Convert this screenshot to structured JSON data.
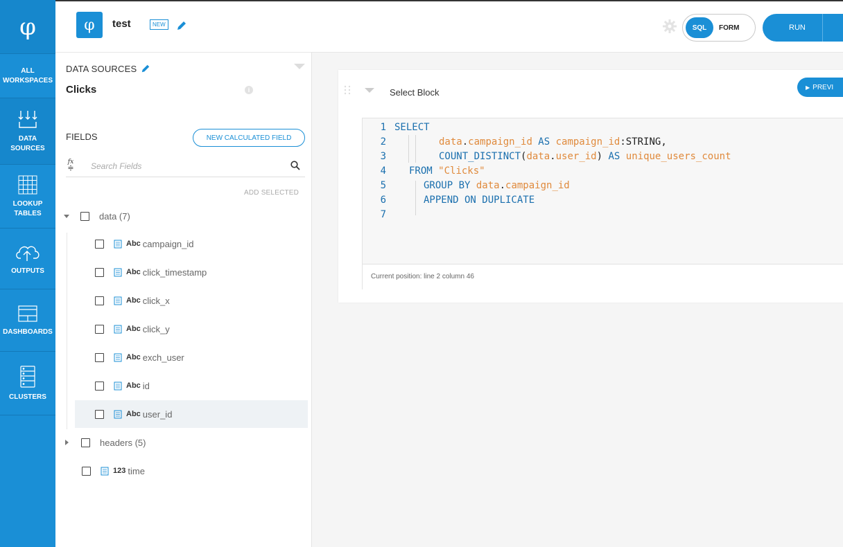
{
  "nav": {
    "logo": "φ",
    "items": [
      {
        "label_line1": "ALL",
        "label_line2": "WORKSPACES",
        "icon": "workspaces-icon"
      },
      {
        "label_line1": "DATA",
        "label_line2": "SOURCES",
        "icon": "data-sources-icon"
      },
      {
        "label_line1": "LOOKUP",
        "label_line2": "TABLES",
        "icon": "grid-icon"
      },
      {
        "label_line1": "OUTPUTS",
        "label_line2": "",
        "icon": "cloud-upload-icon"
      },
      {
        "label_line1": "DASHBOARDS",
        "label_line2": "",
        "icon": "dashboard-icon"
      },
      {
        "label_line1": "CLUSTERS",
        "label_line2": "",
        "icon": "server-icon"
      }
    ]
  },
  "topbar": {
    "workspace_logo": "φ",
    "workspace_name": "test",
    "badge": "NEW",
    "mode_sql": "SQL",
    "mode_form": "FORM",
    "run_label": "RUN"
  },
  "panel": {
    "data_sources_title": "DATA SOURCES",
    "source_name": "Clicks",
    "info": "i",
    "fields_title": "FIELDS",
    "new_calc_label": "NEW CALCULATED FIELD",
    "fx_label": "fx",
    "search_placeholder": "Search Fields",
    "add_selected": "ADD SELECTED",
    "groups": [
      {
        "name": "data (7)",
        "expanded": true,
        "fields": [
          {
            "type": "Abc",
            "name": "campaign_id"
          },
          {
            "type": "Abc",
            "name": "click_timestamp"
          },
          {
            "type": "Abc",
            "name": "click_x"
          },
          {
            "type": "Abc",
            "name": "click_y"
          },
          {
            "type": "Abc",
            "name": "exch_user"
          },
          {
            "type": "Abc",
            "name": "id"
          },
          {
            "type": "Abc",
            "name": "user_id"
          }
        ]
      },
      {
        "name": "headers (5)",
        "expanded": false
      }
    ],
    "root_field": {
      "type": "123",
      "name": "time"
    }
  },
  "editor": {
    "block_title": "Select Block",
    "preview_label": "PREVI",
    "line_numbers": [
      "1",
      "2",
      "3",
      "4",
      "5",
      "6",
      "7"
    ],
    "code": {
      "l1_kw": "SELECT",
      "l2_a": "data",
      "l2_b": ".",
      "l2_c": "campaign_id",
      "l2_d": " AS ",
      "l2_e": "campaign_id",
      "l2_f": ":STRING,",
      "l3_a": "COUNT_DISTINCT",
      "l3_b": "(",
      "l3_c": "data",
      "l3_d": ".",
      "l3_e": "user_id",
      "l3_f": ")",
      "l3_g": " AS ",
      "l3_h": "unique_users_count",
      "l4_a": "FROM ",
      "l4_b": "\"Clicks\"",
      "l5_a": "GROUP BY ",
      "l5_b": "data",
      "l5_c": ".",
      "l5_d": "campaign_id",
      "l6_a": "APPEND ON DUPLICATE"
    },
    "status": "Current position: line 2 column 46"
  },
  "colors": {
    "brand": "#1a8fd6",
    "keyword": "#1a6fae",
    "identifier": "#e08a3c"
  }
}
